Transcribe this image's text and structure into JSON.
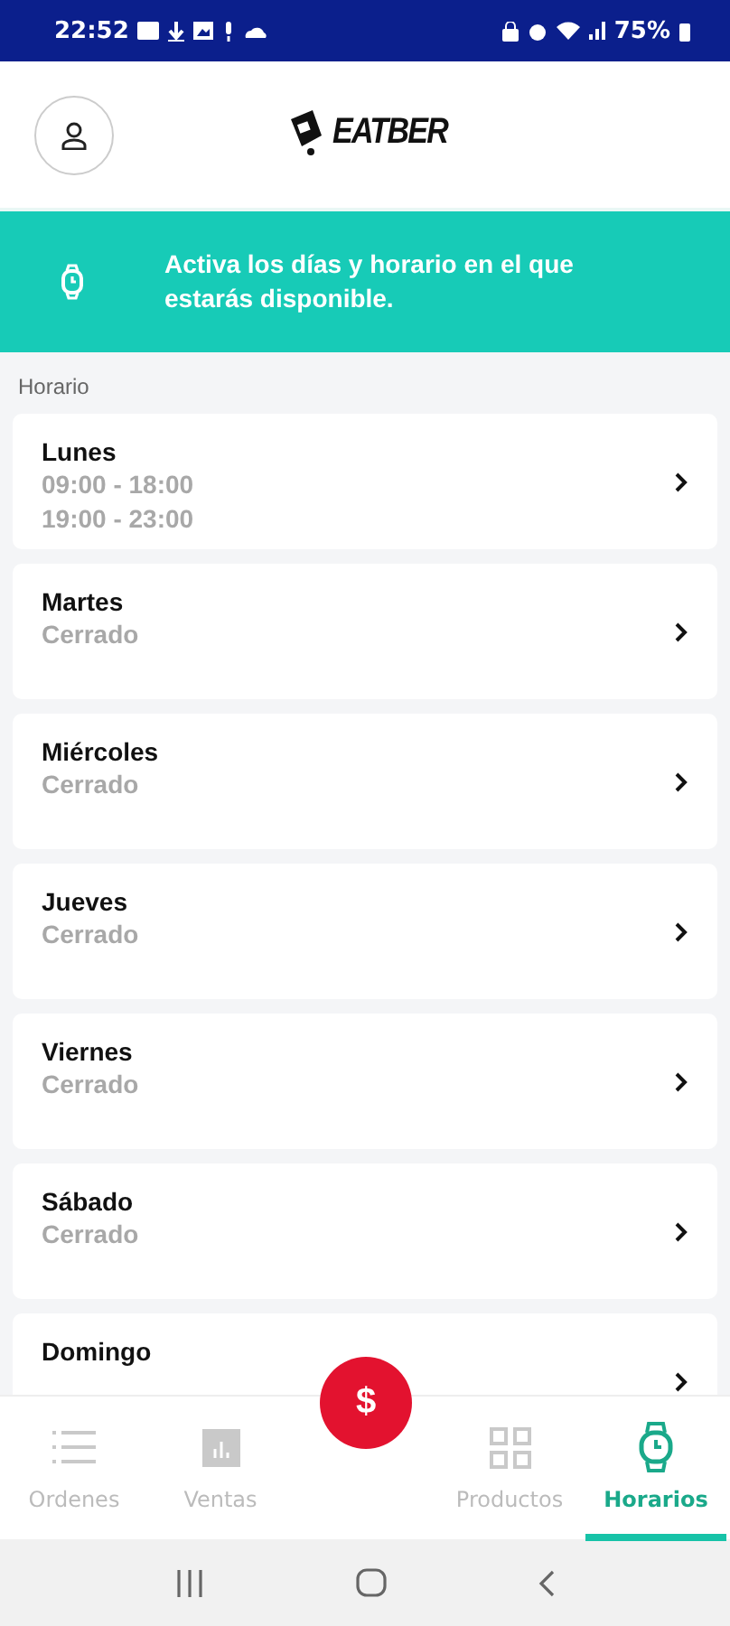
{
  "status_bar": {
    "time": "22:52",
    "battery": "75%"
  },
  "header": {
    "logo": "EATBER"
  },
  "banner": {
    "text": "Activa los días y horario en el que estarás disponible."
  },
  "section_label": "Horario",
  "days": [
    {
      "day": "Lunes",
      "hours": [
        "09:00 - 18:00",
        "19:00 - 23:00"
      ]
    },
    {
      "day": "Martes",
      "hours": [
        "Cerrado"
      ]
    },
    {
      "day": "Miércoles",
      "hours": [
        "Cerrado"
      ]
    },
    {
      "day": "Jueves",
      "hours": [
        "Cerrado"
      ]
    },
    {
      "day": "Viernes",
      "hours": [
        "Cerrado"
      ]
    },
    {
      "day": "Sábado",
      "hours": [
        "Cerrado"
      ]
    },
    {
      "day": "Domingo"
    }
  ],
  "bottom_nav": {
    "fab": "$",
    "items": [
      {
        "label": "Ordenes",
        "selected": false
      },
      {
        "label": "Ventas",
        "selected": false
      },
      {
        "label": "Productos",
        "selected": false
      },
      {
        "label": "Horarios",
        "selected": true
      }
    ]
  }
}
